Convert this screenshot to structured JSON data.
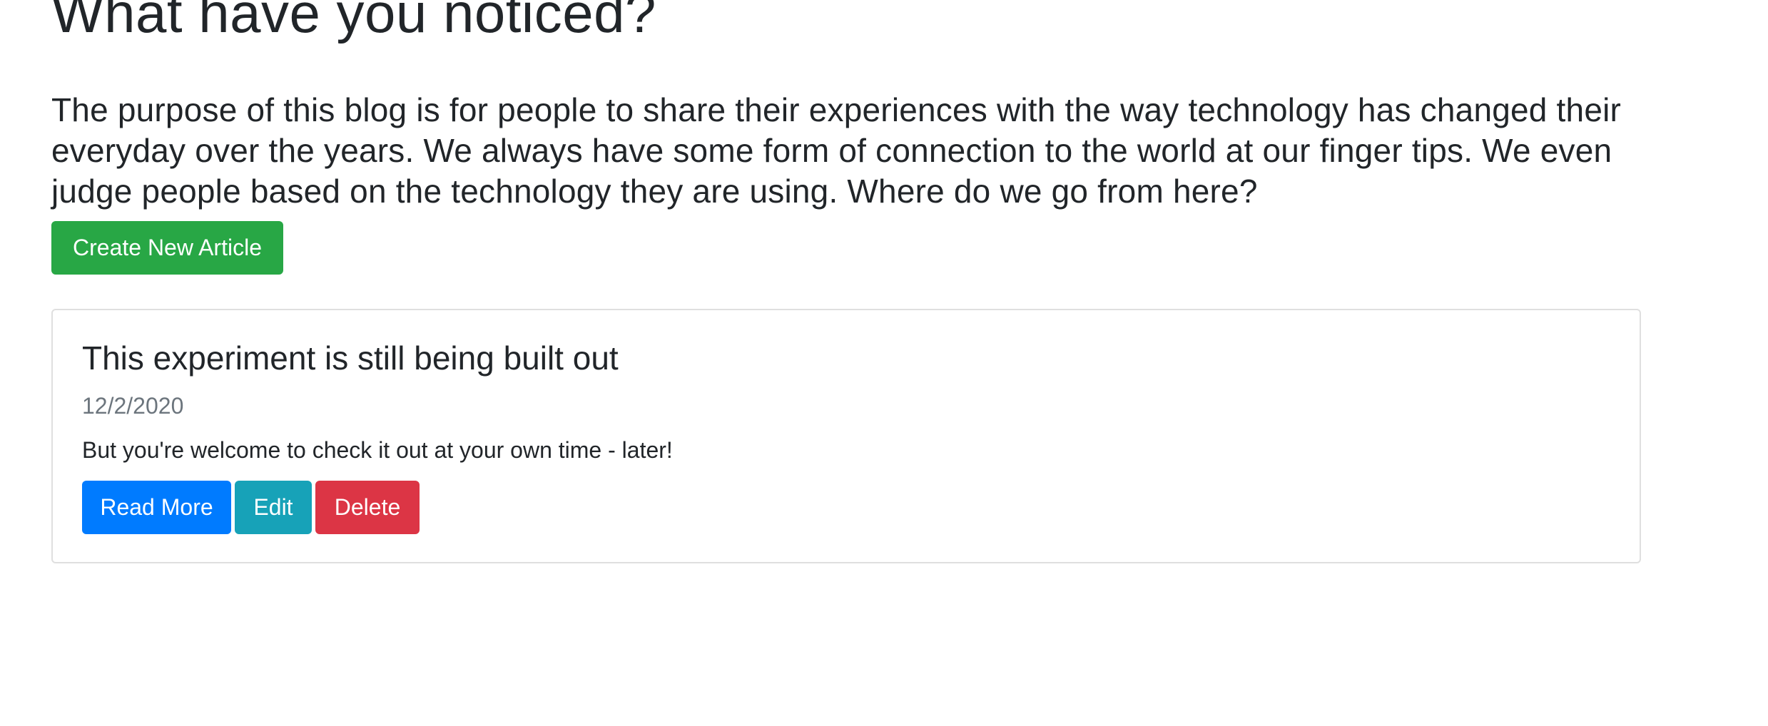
{
  "header": {
    "title": "What have you noticed?",
    "intro": "The purpose of this blog is for people to share their experiences with the way technology has changed their everyday over the years. We always have some form of connection to the world at our finger tips. We even judge people based on the technology they are using. Where do we go from here?",
    "create_button_label": "Create New Article"
  },
  "articles": [
    {
      "title": "This experiment is still being built out",
      "date": "12/2/2020",
      "description": "But you're welcome to check it out at your own time - later!",
      "read_more_label": "Read More",
      "edit_label": "Edit",
      "delete_label": "Delete"
    }
  ],
  "colors": {
    "create_button": "#28a745",
    "read_more_button": "#007bff",
    "edit_button": "#17a2b8",
    "delete_button": "#dc3545",
    "muted_text": "#6c757d",
    "card_border": "#dfdfdf"
  }
}
